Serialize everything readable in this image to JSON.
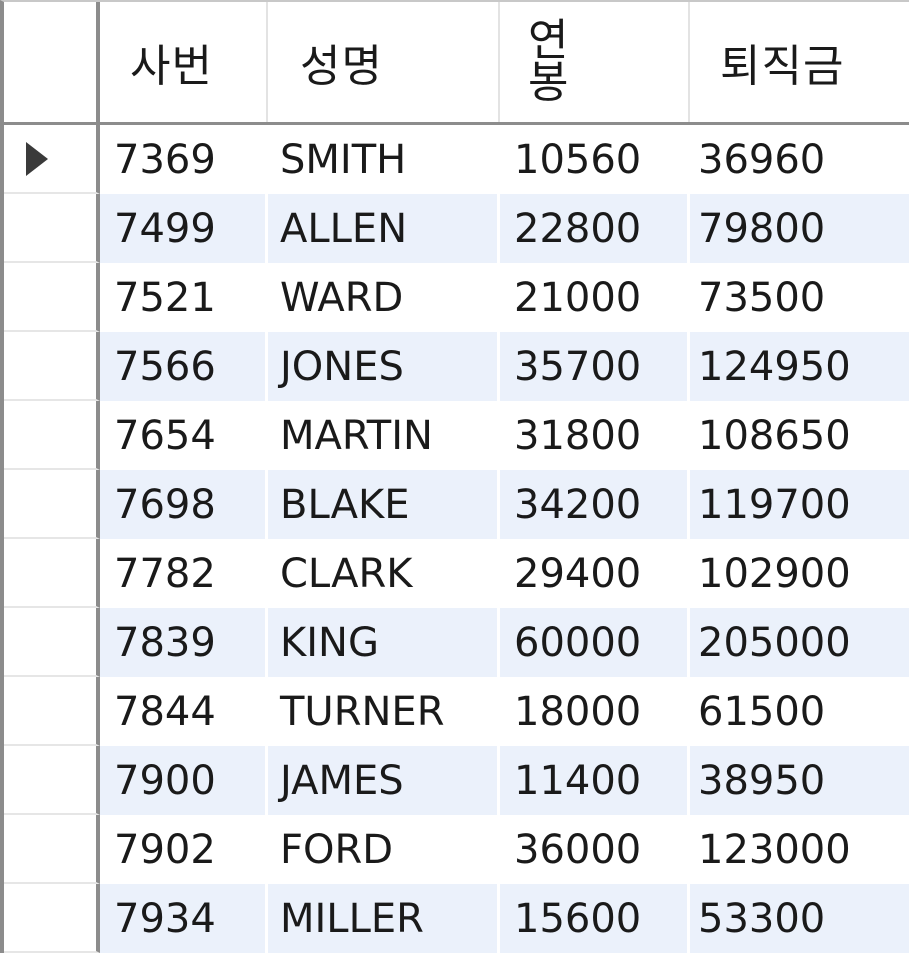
{
  "headers": {
    "empno": "사번",
    "ename": "성명",
    "salary": "연봉",
    "severance": "퇴직금"
  },
  "rows": [
    {
      "empno": "7369",
      "ename": "SMITH",
      "salary": "10560",
      "severance": "36960"
    },
    {
      "empno": "7499",
      "ename": "ALLEN",
      "salary": "22800",
      "severance": "79800"
    },
    {
      "empno": "7521",
      "ename": "WARD",
      "salary": "21000",
      "severance": "73500"
    },
    {
      "empno": "7566",
      "ename": "JONES",
      "salary": "35700",
      "severance": "124950"
    },
    {
      "empno": "7654",
      "ename": "MARTIN",
      "salary": "31800",
      "severance": "108650"
    },
    {
      "empno": "7698",
      "ename": "BLAKE",
      "salary": "34200",
      "severance": "119700"
    },
    {
      "empno": "7782",
      "ename": "CLARK",
      "salary": "29400",
      "severance": "102900"
    },
    {
      "empno": "7839",
      "ename": "KING",
      "salary": "60000",
      "severance": "205000"
    },
    {
      "empno": "7844",
      "ename": "TURNER",
      "salary": "18000",
      "severance": "61500"
    },
    {
      "empno": "7900",
      "ename": "JAMES",
      "salary": "11400",
      "severance": "38950"
    },
    {
      "empno": "7902",
      "ename": "FORD",
      "salary": "36000",
      "severance": "123000"
    },
    {
      "empno": "7934",
      "ename": "MILLER",
      "salary": "15600",
      "severance": "53300"
    }
  ],
  "current_row_icon": "row-pointer-icon"
}
